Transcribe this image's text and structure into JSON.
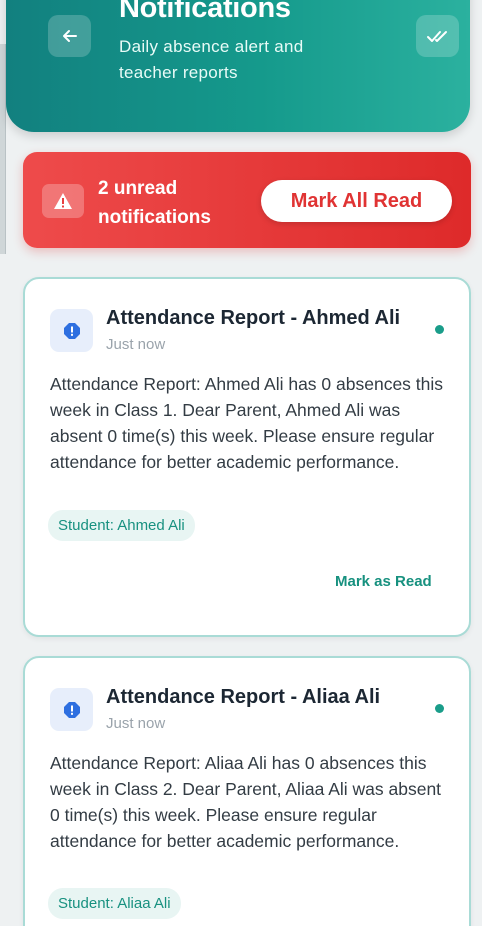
{
  "header": {
    "title": "Notifications",
    "subtitle": "Daily absence alert and teacher reports",
    "back_icon": "arrow-left-icon",
    "mark_all_icon": "double-check-icon",
    "accent_color": "#159a8c"
  },
  "unread_banner": {
    "text": "2 unread notifications",
    "button_label": "Mark All Read",
    "icon": "warning-icon",
    "color": "#e33434"
  },
  "notifications": [
    {
      "title": "Attendance Report - Ahmed Ali",
      "time": "Just now",
      "message": "Attendance Report: Ahmed Ali has 0 absences this week in Class 1. Dear Parent, Ahmed Ali was absent 0 time(s) this week. Please ensure regular attendance for better academic performance.",
      "student": "Student: Ahmed Ali",
      "action_label": "Mark as Read",
      "icon": "alert-icon",
      "unread": true
    },
    {
      "title": "Attendance Report - Aliaa Ali",
      "time": "Just now",
      "message": "Attendance Report: Aliaa Ali has 0 absences this week in Class 2. Dear Parent, Aliaa Ali was absent 0 time(s) this week. Please ensure regular attendance for better academic performance.",
      "student": "Student: Aliaa Ali",
      "icon": "alert-icon",
      "unread": true
    }
  ]
}
